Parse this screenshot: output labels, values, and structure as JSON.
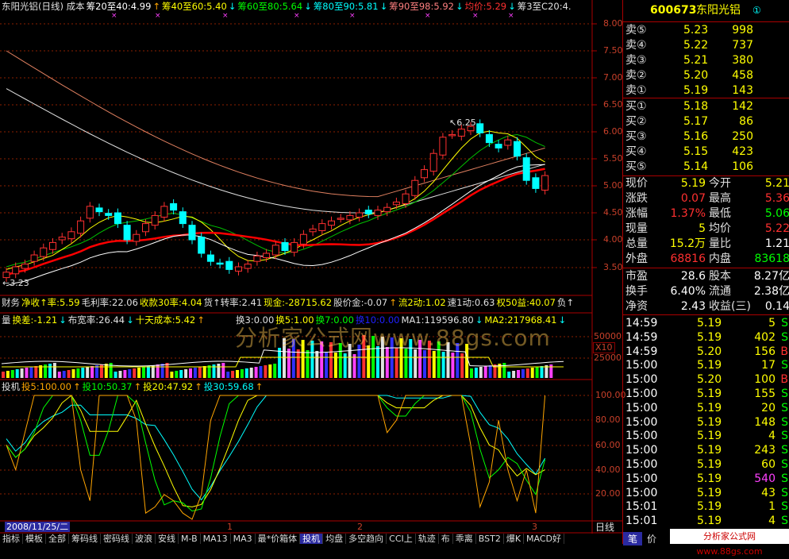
{
  "chart": {
    "title_parts": [
      {
        "text": "东阳光铝(日线) 成本",
        "color": "#e0e0e0"
      },
      {
        "text": "筹20至40:4.99",
        "color": "#ffffff"
      },
      {
        "text": "↑",
        "color": "#ffa500"
      },
      {
        "text": "筹40至60:5.40",
        "color": "#ffff00"
      },
      {
        "text": "↓",
        "color": "#00ffff"
      },
      {
        "text": "筹60至80:5.64",
        "color": "#00ff00"
      },
      {
        "text": "↓",
        "color": "#00ffff"
      },
      {
        "text": "筹80至90:5.81",
        "color": "#00ffff"
      },
      {
        "text": "↓",
        "color": "#00ffff"
      },
      {
        "text": "筹90至98:5.92",
        "color": "#ff8080"
      },
      {
        "text": "↓",
        "color": "#00ffff"
      },
      {
        "text": "均价:5.29",
        "color": "#ff3030"
      },
      {
        "text": "↓",
        "color": "#00ffff"
      },
      {
        "text": "筹3至C20:4.",
        "color": "#e0e0e0"
      }
    ],
    "price_axis": [
      "8.00",
      "7.50",
      "7.00",
      "6.50",
      "6.00",
      "5.50",
      "5.00",
      "4.50",
      "4.00",
      "3.50"
    ],
    "high_label": "6.25",
    "low_label": "3.23",
    "finance_parts": [
      {
        "text": "财务",
        "color": "#e0e0e0"
      },
      {
        "text": "净收↑率:5.59",
        "color": "#ffff00"
      },
      {
        "text": "毛利率:22.06",
        "color": "#e0e0e0"
      },
      {
        "text": "收款30率:4.04",
        "color": "#ffff00"
      },
      {
        "text": "货↑转率:2.41",
        "color": "#e0e0e0"
      },
      {
        "text": "现金:-28715.62",
        "color": "#ffff00"
      },
      {
        "text": "股价金:-0.07",
        "color": "#e0e0e0"
      },
      {
        "text": "↑",
        "color": "#ffa500"
      },
      {
        "text": "流2动:1.02",
        "color": "#ffff00"
      },
      {
        "text": "速1动:0.63",
        "color": "#e0e0e0"
      },
      {
        "text": "权50益:40.07",
        "color": "#ffff00"
      },
      {
        "text": "负↑",
        "color": "#e0e0e0"
      }
    ],
    "vol_parts": [
      {
        "text": "量",
        "color": "#e0e0e0"
      },
      {
        "text": "换差:-1.21",
        "color": "#ffff00"
      },
      {
        "text": "↓",
        "color": "#00ffff"
      },
      {
        "text": "布宽率:26.44",
        "color": "#e0e0e0"
      },
      {
        "text": "↓",
        "color": "#00ffff"
      },
      {
        "text": "十天成本:5.42",
        "color": "#ffff00"
      },
      {
        "text": "↑",
        "color": "#ffa500"
      }
    ],
    "vol_parts2": [
      {
        "text": "换3:0.00",
        "color": "#e0e0e0"
      },
      {
        "text": "换5:1.00",
        "color": "#ffff00"
      },
      {
        "text": "换7:0.00",
        "color": "#00ff00"
      },
      {
        "text": "换10:0.00",
        "color": "#2020ff"
      },
      {
        "text": "MA1:119596.80",
        "color": "#e0e0e0"
      },
      {
        "text": "↓",
        "color": "#00ffff"
      },
      {
        "text": "MA2:217968.41",
        "color": "#ffff00"
      },
      {
        "text": "↓",
        "color": "#00ffff"
      }
    ],
    "vol_axis": [
      "50000",
      "25000"
    ],
    "vol_unit": "X10",
    "ind_parts": [
      {
        "text": "投机",
        "color": "#e0e0e0"
      },
      {
        "text": "投5:100.00",
        "color": "#ffa500"
      },
      {
        "text": "↑",
        "color": "#ffa500"
      },
      {
        "text": "投10:50.37",
        "color": "#00ff00"
      },
      {
        "text": "↑",
        "color": "#ffa500"
      },
      {
        "text": "投20:47.92",
        "color": "#ffff00"
      },
      {
        "text": "↑",
        "color": "#ffa500"
      },
      {
        "text": "投30:59.68",
        "color": "#00ffff"
      },
      {
        "text": "↑",
        "color": "#ffa500"
      }
    ],
    "ind_axis": [
      "100.00",
      "80.00",
      "60.00",
      "40.00",
      "20.00"
    ],
    "date_label": "2008/11/25/二",
    "period_label": "日线",
    "scroll_marks": [
      "1",
      "2",
      "3"
    ],
    "watermark": "分析家公式网www.88gs.com",
    "colors": {
      "up": "#ff3030",
      "down": "#00ffff",
      "ma_red": "#ff0000",
      "bg": "#000000",
      "grid": "#8b0000"
    }
  },
  "tabs": [
    "指标",
    "模板",
    "全部",
    "筹码线",
    "密码线",
    "波浪",
    "安线",
    "M-B",
    "MA13",
    "MA3",
    "最*价箱体",
    "投机",
    "均盘",
    "多空趋向",
    "CCI上",
    "轨迹",
    "布",
    "乖离",
    "BST2",
    "爆K",
    "MACD好"
  ],
  "active_tab": "投机",
  "quote": {
    "code": "600673",
    "name": "东阳光铝",
    "badge": "①",
    "asks": [
      {
        "label": "卖⑤",
        "price": "5.23",
        "vol": "998"
      },
      {
        "label": "卖④",
        "price": "5.22",
        "vol": "737"
      },
      {
        "label": "卖③",
        "price": "5.21",
        "vol": "380"
      },
      {
        "label": "卖②",
        "price": "5.20",
        "vol": "458"
      },
      {
        "label": "卖①",
        "price": "5.19",
        "vol": "143"
      }
    ],
    "bids": [
      {
        "label": "买①",
        "price": "5.18",
        "vol": "142"
      },
      {
        "label": "买②",
        "price": "5.17",
        "vol": "86"
      },
      {
        "label": "买③",
        "price": "5.16",
        "vol": "250"
      },
      {
        "label": "买④",
        "price": "5.15",
        "vol": "423"
      },
      {
        "label": "买⑤",
        "price": "5.14",
        "vol": "106"
      }
    ],
    "stats": [
      {
        "l1": "现价",
        "v1": "5.19",
        "l2": "今开",
        "v2": "5.21",
        "c1": "#ffff00",
        "c2": "#ffff00"
      },
      {
        "l1": "涨跌",
        "v1": "0.07",
        "l2": "最高",
        "v2": "5.36",
        "c1": "#ff3030",
        "c2": "#ff3030"
      },
      {
        "l1": "涨幅",
        "v1": "1.37%",
        "l2": "最低",
        "v2": "5.06",
        "c1": "#ff3030",
        "c2": "#00ff00"
      },
      {
        "l1": "现量",
        "v1": "5",
        "l2": "均价",
        "v2": "5.22",
        "c1": "#ffff00",
        "c2": "#ff3030"
      },
      {
        "l1": "总量",
        "v1": "15.2万",
        "l2": "量比",
        "v2": "1.21",
        "c1": "#ffff00",
        "c2": "#ffffff"
      },
      {
        "l1": "外盘",
        "v1": "68816",
        "l2": "内盘",
        "v2": "83618",
        "c1": "#ff3030",
        "c2": "#00ff00"
      }
    ],
    "fund": [
      {
        "l1": "市盈",
        "v1": "28.6",
        "l2": "股本",
        "v2": "8.27亿"
      },
      {
        "l1": "换手",
        "v1": "6.40%",
        "l2": "流通",
        "v2": "2.38亿"
      },
      {
        "l1": "净资",
        "v1": "2.43",
        "l2": "收益(三)",
        "v2": "0.14"
      }
    ],
    "ticks": [
      {
        "t": "14:59",
        "p": "5.19",
        "v": "5",
        "s": "S",
        "vc": "#ffff00",
        "sc": "#00ff00"
      },
      {
        "t": "14:59",
        "p": "5.19",
        "v": "402",
        "s": "S",
        "vc": "#ffff00",
        "sc": "#00ff00"
      },
      {
        "t": "14:59",
        "p": "5.20",
        "v": "156",
        "s": "B",
        "vc": "#ffff00",
        "sc": "#ff3030"
      },
      {
        "t": "15:00",
        "p": "5.19",
        "v": "17",
        "s": "S",
        "vc": "#ffff00",
        "sc": "#00ff00"
      },
      {
        "t": "15:00",
        "p": "5.20",
        "v": "100",
        "s": "B",
        "vc": "#ffff00",
        "sc": "#ff3030"
      },
      {
        "t": "15:00",
        "p": "5.19",
        "v": "155",
        "s": "S",
        "vc": "#ffff00",
        "sc": "#00ff00"
      },
      {
        "t": "15:00",
        "p": "5.19",
        "v": "20",
        "s": "S",
        "vc": "#ffff00",
        "sc": "#00ff00"
      },
      {
        "t": "15:00",
        "p": "5.19",
        "v": "148",
        "s": "S",
        "vc": "#ffff00",
        "sc": "#00ff00"
      },
      {
        "t": "15:00",
        "p": "5.19",
        "v": "4",
        "s": "S",
        "vc": "#ffff00",
        "sc": "#00ff00"
      },
      {
        "t": "15:00",
        "p": "5.19",
        "v": "243",
        "s": "S",
        "vc": "#ffff00",
        "sc": "#00ff00"
      },
      {
        "t": "15:00",
        "p": "5.19",
        "v": "60",
        "s": "S",
        "vc": "#ffff00",
        "sc": "#00ff00"
      },
      {
        "t": "15:00",
        "p": "5.19",
        "v": "540",
        "s": "S",
        "vc": "#ff40ff",
        "sc": "#00ff00"
      },
      {
        "t": "15:00",
        "p": "5.19",
        "v": "43",
        "s": "S",
        "vc": "#ffff00",
        "sc": "#00ff00"
      },
      {
        "t": "15:01",
        "p": "5.19",
        "v": "1",
        "s": "S",
        "vc": "#ffff00",
        "sc": "#00ff00"
      },
      {
        "t": "15:01",
        "p": "5.19",
        "v": "4",
        "s": "S",
        "vc": "#ffff00",
        "sc": "#00ff00"
      }
    ],
    "bottom_tabs": [
      "笔",
      "价"
    ],
    "footer": "分析家公式网 www.88gs.com"
  }
}
